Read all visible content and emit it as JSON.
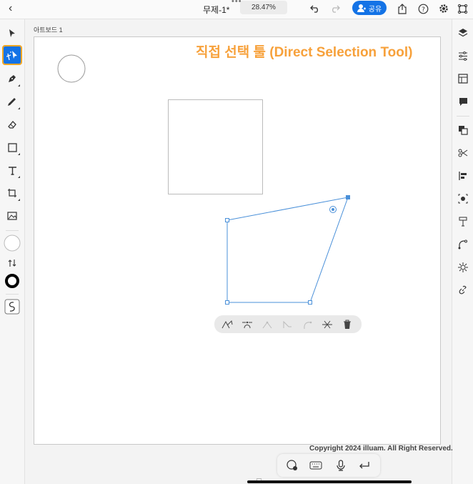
{
  "topbar": {
    "back_glyph": "‹",
    "more_glyph": "•••",
    "doc_title": "무제-1*",
    "zoom": "28.47%",
    "share_label": "공유",
    "icons": [
      "undo-icon",
      "redo-icon",
      "share-user-icon",
      "export-icon",
      "help-icon",
      "settings-icon",
      "plugins-icon"
    ]
  },
  "left_tools": [
    "selection-tool",
    "direct-selection-tool",
    "pen-tool",
    "pencil-tool",
    "eraser-tool",
    "shape-tool",
    "type-tool",
    "transform-tool",
    "image-tool",
    "fill-color",
    "swap-colors",
    "stroke-color",
    "path-tool"
  ],
  "right_tools": [
    "layers",
    "properties",
    "libraries",
    "comments",
    "arrange",
    "cut",
    "align",
    "repeat-grid",
    "text-style",
    "path-options",
    "effects",
    "link"
  ],
  "canvas": {
    "artboard_label": "아트보드 1",
    "heading": "직접 선택 툴 (Direct Selection Tool)",
    "copyright": "Copyright 2024 illuam. All Right Reserved."
  },
  "context_bar": [
    "anchor-convert-icon",
    "anchor-smooth-icon",
    "anchor-corner-icon",
    "anchor-remove-icon",
    "anchor-curve-icon",
    "anchor-join-icon",
    "delete-icon"
  ],
  "bottom_bar": [
    "touch-modifier-icon",
    "keyboard-icon",
    "microphone-icon",
    "return-icon"
  ],
  "colors": {
    "accent": "#1473e6",
    "highlight": "#f5a623",
    "heading": "#f7a13b",
    "path": "#4a90d9"
  }
}
